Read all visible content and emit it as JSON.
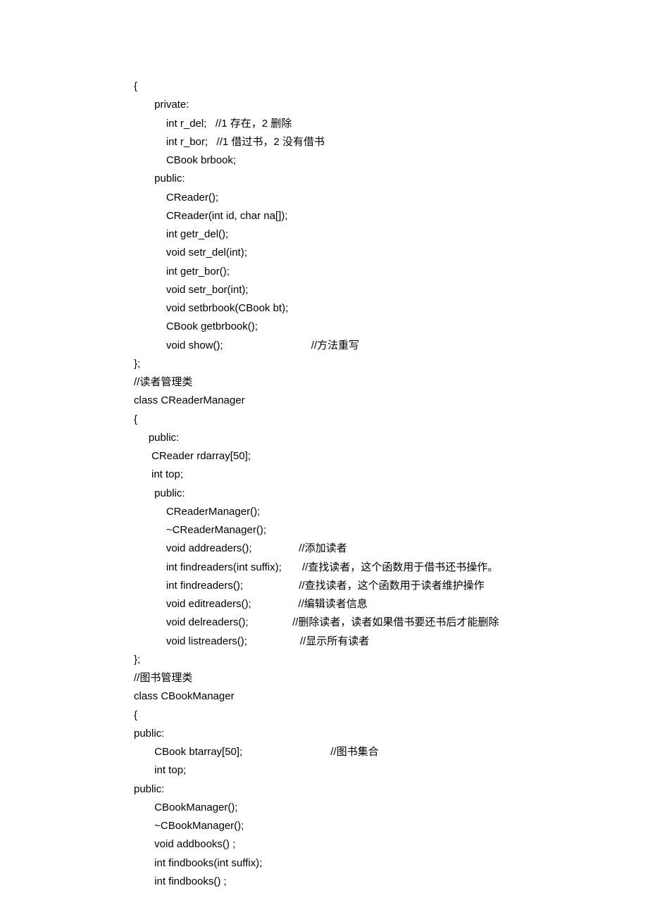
{
  "lines": [
    "{",
    "       private:",
    "           int r_del;   //1 存在，2 删除",
    "           int r_bor;   //1 借过书，2 没有借书",
    "           CBook brbook;",
    "       public:",
    "           CReader();",
    "           CReader(int id, char na[]);",
    "           int getr_del();",
    "           void setr_del(int);",
    "           int getr_bor();",
    "           void setr_bor(int);",
    "           void setbrbook(CBook bt);",
    "           CBook getbrbook();",
    "           void show();                              //方法重写",
    "};",
    "//读者管理类",
    "class CReaderManager",
    "{",
    "     public:",
    "      CReader rdarray[50];",
    "      int top;",
    "       public:",
    "           CReaderManager();",
    "           ~CReaderManager();",
    "           void addreaders();                //添加读者",
    "           int findreaders(int suffix);       //查找读者，这个函数用于借书还书操作。",
    "           int findreaders();                   //查找读者，这个函数用于读者维护操作",
    "           void editreaders();                //编辑读者信息",
    "           void delreaders();               //删除读者，读者如果借书要还书后才能删除",
    "           void listreaders();                  //显示所有读者",
    "};",
    "//图书管理类",
    "class CBookManager",
    "{",
    "public:",
    "       CBook btarray[50];                              //图书集合",
    "       int top;",
    "public:",
    "       CBookManager();",
    "       ~CBookManager();",
    "       void addbooks() ;",
    "       int findbooks(int suffix);",
    "       int findbooks() ;"
  ]
}
